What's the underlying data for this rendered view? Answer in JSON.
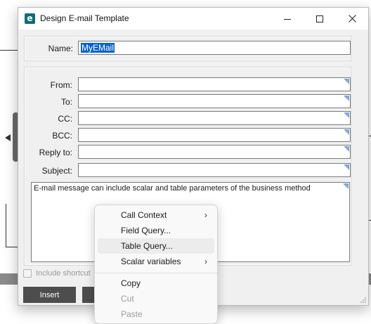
{
  "window": {
    "title": "Design E-mail Template",
    "icon_letter": "e",
    "minimize_icon": "minimize-icon",
    "maximize_icon": "maximize-icon",
    "close_icon": "close-icon"
  },
  "name_field": {
    "label": "Name:",
    "value": "MyEMail"
  },
  "fields": {
    "from_label": "From:",
    "to_label": "To:",
    "cc_label": "CC:",
    "bcc_label": "BCC:",
    "reply_to_label": "Reply to:",
    "subject_label": "Subject:",
    "from_value": "",
    "to_value": "",
    "cc_value": "",
    "bcc_value": "",
    "reply_to_value": "",
    "subject_value": ""
  },
  "body": {
    "text": "E-mail message can include scalar and table parameters of the business method"
  },
  "options": {
    "include_shortcut_label": "Include shortcut",
    "include_shortcut_checked": false
  },
  "buttons": {
    "insert_label": "Insert",
    "second_label": ""
  },
  "context_menu": {
    "items": [
      {
        "label": "Call Context",
        "submenu": true,
        "disabled": false,
        "hover": false
      },
      {
        "label": "Field Query...",
        "submenu": false,
        "disabled": false,
        "hover": false
      },
      {
        "label": "Table Query...",
        "submenu": false,
        "disabled": false,
        "hover": true
      },
      {
        "label": "Scalar variables",
        "submenu": true,
        "disabled": false,
        "hover": false
      },
      {
        "label": "Copy",
        "submenu": false,
        "disabled": false,
        "hover": false
      },
      {
        "label": "Cut",
        "submenu": false,
        "disabled": true,
        "hover": false
      },
      {
        "label": "Paste",
        "submenu": false,
        "disabled": true,
        "hover": false
      }
    ],
    "submenu_arrow": "›"
  },
  "colors": {
    "accent": "#0f6e7a",
    "selection": "#0a64c8",
    "field_corner": "#7fa8d8",
    "button_dark": "#4d4d4d"
  }
}
